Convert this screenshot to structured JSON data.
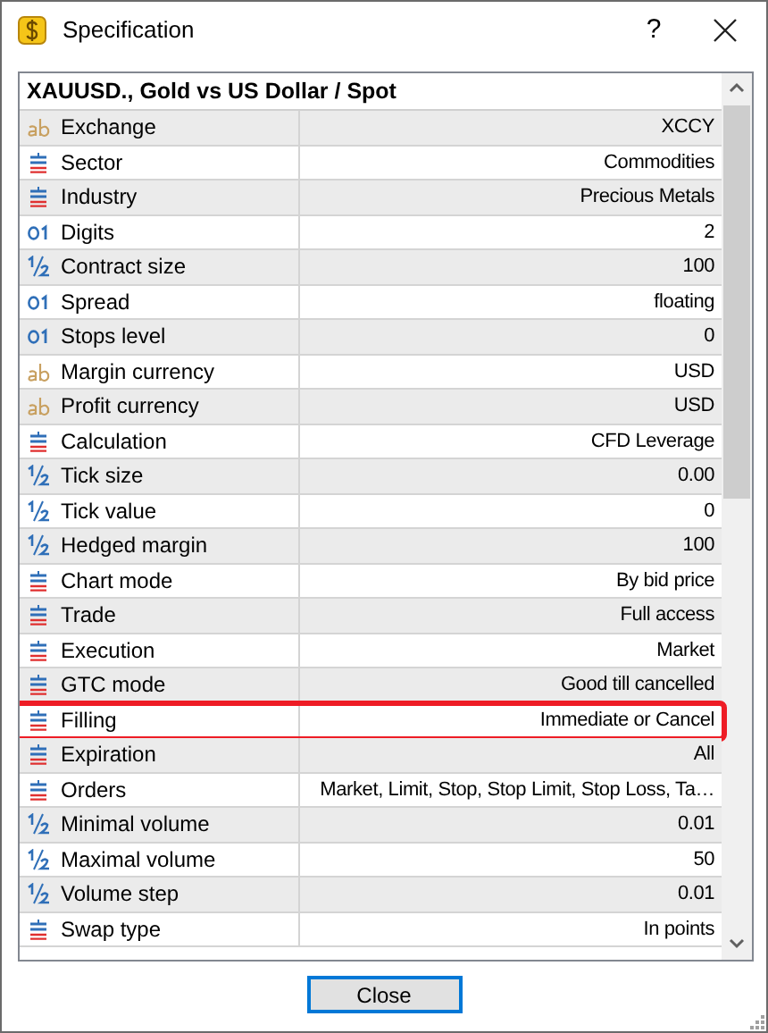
{
  "window": {
    "title": "Specification",
    "help": "?"
  },
  "symbol_header": "XAUUSD., Gold vs US Dollar / Spot",
  "rows": [
    {
      "kind": "text",
      "label": "Exchange",
      "value": "XCCY",
      "annotated": false
    },
    {
      "kind": "enum",
      "label": "Sector",
      "value": "Commodities",
      "annotated": false
    },
    {
      "kind": "enum",
      "label": "Industry",
      "value": "Precious Metals",
      "annotated": false
    },
    {
      "kind": "integer",
      "label": "Digits",
      "value": "2",
      "annotated": false
    },
    {
      "kind": "double",
      "label": "Contract size",
      "value": "100",
      "annotated": false
    },
    {
      "kind": "integer",
      "label": "Spread",
      "value": "floating",
      "annotated": false
    },
    {
      "kind": "integer",
      "label": "Stops level",
      "value": "0",
      "annotated": false
    },
    {
      "kind": "text",
      "label": "Margin currency",
      "value": "USD",
      "annotated": false
    },
    {
      "kind": "text",
      "label": "Profit currency",
      "value": "USD",
      "annotated": false
    },
    {
      "kind": "enum",
      "label": "Calculation",
      "value": "CFD Leverage",
      "annotated": false
    },
    {
      "kind": "double",
      "label": "Tick size",
      "value": "0.00",
      "annotated": false
    },
    {
      "kind": "double",
      "label": "Tick value",
      "value": "0",
      "annotated": false
    },
    {
      "kind": "double",
      "label": "Hedged margin",
      "value": "100",
      "annotated": false
    },
    {
      "kind": "enum",
      "label": "Chart mode",
      "value": "By bid price",
      "annotated": false
    },
    {
      "kind": "enum",
      "label": "Trade",
      "value": "Full access",
      "annotated": false
    },
    {
      "kind": "enum",
      "label": "Execution",
      "value": "Market",
      "annotated": false
    },
    {
      "kind": "enum",
      "label": "GTC mode",
      "value": "Good till cancelled",
      "annotated": false
    },
    {
      "kind": "enum",
      "label": "Filling",
      "value": "Immediate or Cancel",
      "annotated": true
    },
    {
      "kind": "enum",
      "label": "Expiration",
      "value": "All",
      "annotated": false
    },
    {
      "kind": "enum",
      "label": "Orders",
      "value": "Market, Limit, Stop, Stop Limit, Stop Loss, Ta…",
      "annotated": false
    },
    {
      "kind": "double",
      "label": "Minimal volume",
      "value": "0.01",
      "annotated": false
    },
    {
      "kind": "double",
      "label": "Maximal volume",
      "value": "50",
      "annotated": false
    },
    {
      "kind": "double",
      "label": "Volume step",
      "value": "0.01",
      "annotated": false
    },
    {
      "kind": "enum",
      "label": "Swap type",
      "value": "In points",
      "annotated": false
    }
  ],
  "buttons": [
    {
      "label": "Close"
    }
  ]
}
